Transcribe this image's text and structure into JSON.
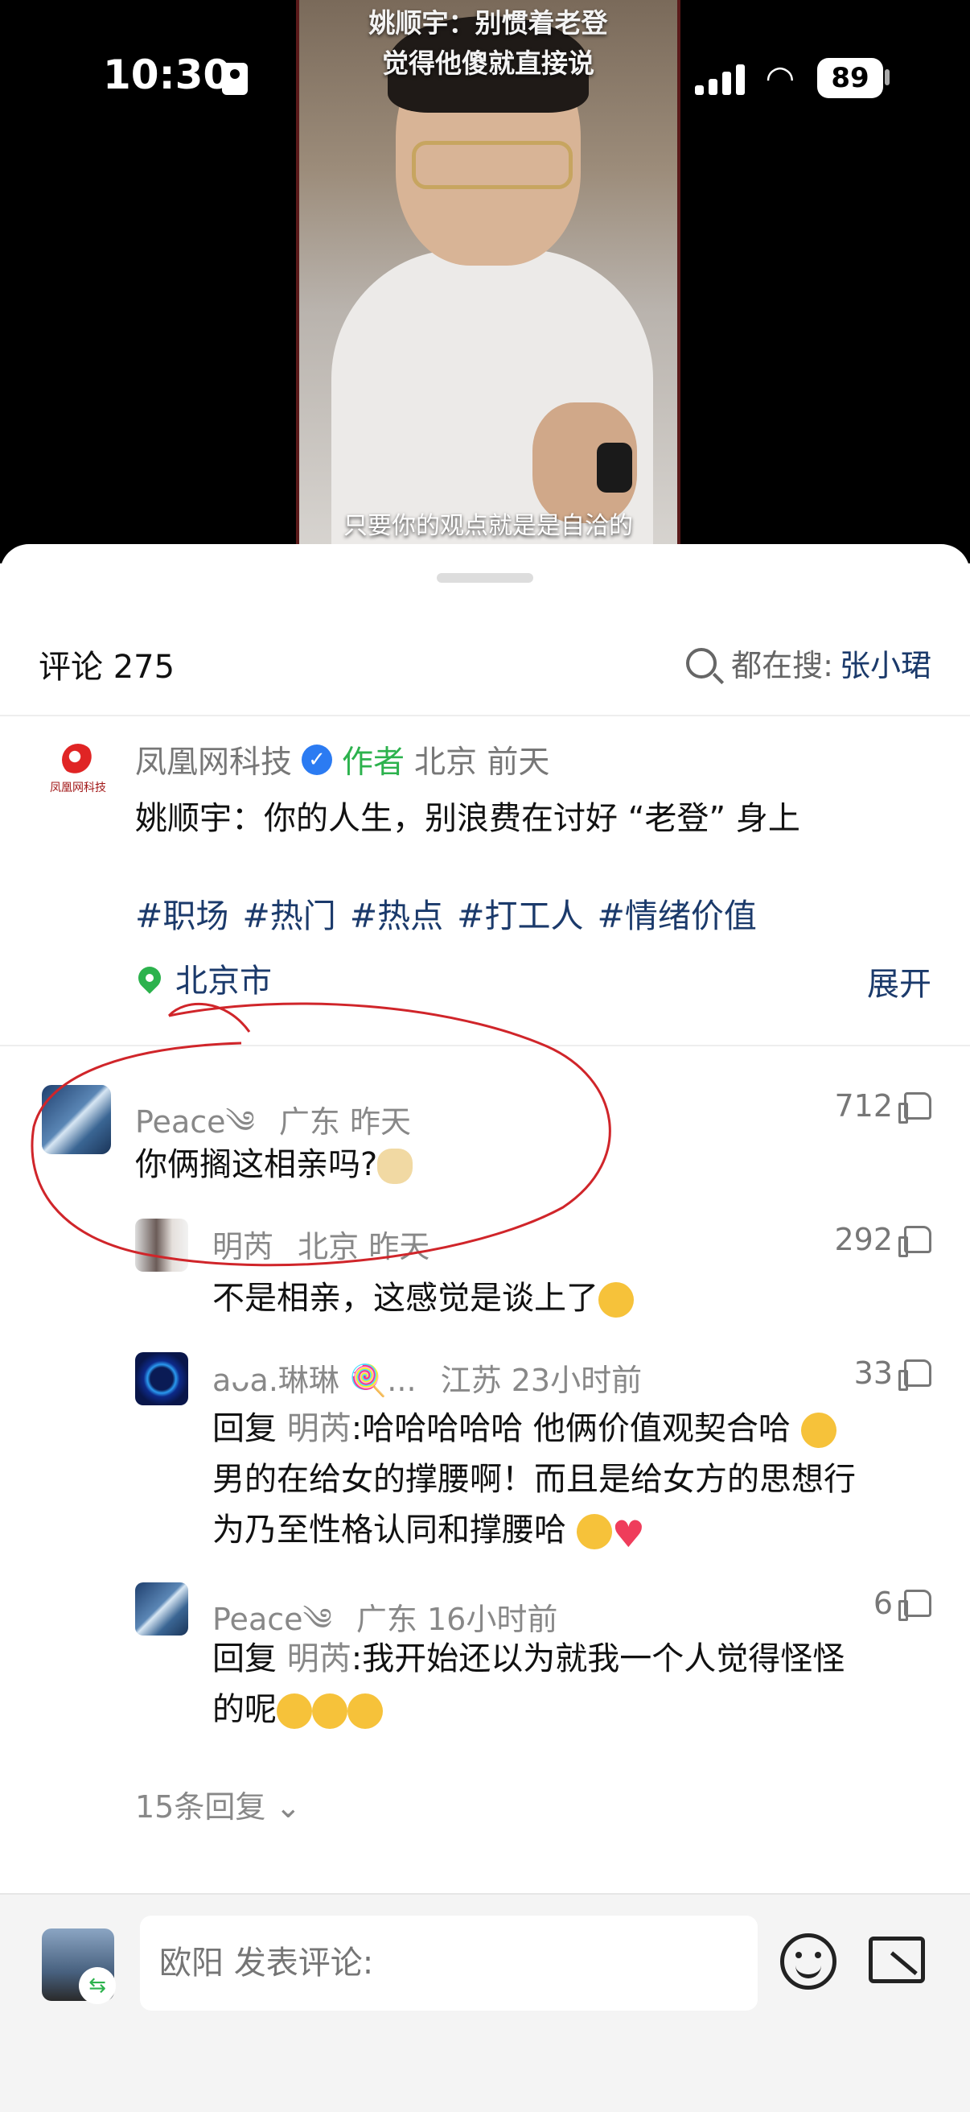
{
  "status_bar": {
    "time": "10:30",
    "battery": "89"
  },
  "video": {
    "title_line1": "姚顺宇：别惯着老登",
    "title_line2": "觉得他傻就直接说",
    "subtitle": "只要你的观点就是是自洽的"
  },
  "header": {
    "comments_label": "评论 275",
    "search_prefix": "都在搜:",
    "search_term": "张小珺"
  },
  "post": {
    "logo_text": "凤凰网科技",
    "author": "凤凰网科技",
    "author_tag": "作者",
    "meta": "北京 前天",
    "text": "姚顺宇：你的人生，别浪费在讨好 “老登” 身上",
    "tags": "#职场 #热门 #热点 #打工人 #情绪价值",
    "location": "北京市",
    "expand_label": "展开"
  },
  "comments": [
    {
      "name": "Peace༄",
      "meta": "广东 昨天",
      "likes": "712",
      "text": "你俩搁这相亲吗?"
    },
    {
      "name": "明芮",
      "meta": "北京 昨天",
      "likes": "292",
      "text": "不是相亲，这感觉是谈上了"
    },
    {
      "name": "aᴗa.琳琳 🍭...",
      "meta": "江苏 23小时前",
      "likes": "33",
      "reply_prefix": "回复",
      "reply_to": "明芮",
      "text_line1": ":哈哈哈哈哈 他俩价值观契合哈",
      "text_line2": "男的在给女的撑腰啊！而且是给女方的思想行",
      "text_line3": "为乃至性格认同和撑腰哈"
    },
    {
      "name": "Peace༄",
      "meta": "广东 16小时前",
      "likes": "6",
      "reply_prefix": "回复",
      "reply_to": "明芮",
      "text_line1": ":我开始还以为就我一个人觉得怪怪",
      "text_line2": "的呢"
    }
  ],
  "more_replies": "15条回复 ⌄",
  "bottom_bar": {
    "input_placeholder": "欧阳 发表评论:"
  },
  "colors": {
    "link_blue": "#1b3a6b",
    "author_green": "#2cb24d",
    "annotation_red": "#d0252a"
  }
}
